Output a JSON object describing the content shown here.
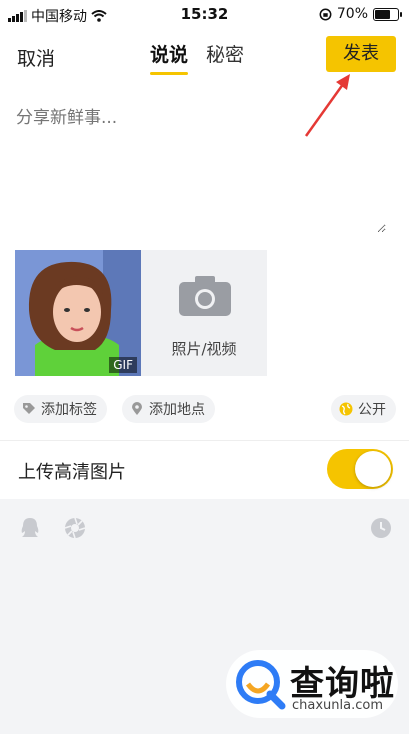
{
  "status_bar": {
    "carrier": "中国移动",
    "time": "15:32",
    "battery_percent": "70%",
    "battery_level": 0.7
  },
  "nav": {
    "cancel_label": "取消",
    "tabs": [
      {
        "label": "说说",
        "active": true
      },
      {
        "label": "秘密",
        "active": false
      }
    ],
    "publish_label": "发表"
  },
  "compose": {
    "placeholder": "分享新鲜事..."
  },
  "media": {
    "thumbnail_badge": "GIF",
    "add_label": "照片/视频"
  },
  "chips": {
    "tag_label": "添加标签",
    "location_label": "添加地点",
    "visibility_label": "公开"
  },
  "upload_hd": {
    "label": "上传高清图片",
    "enabled": true
  },
  "bottom_icons": [
    "qq-icon",
    "aperture-icon",
    "clock-icon"
  ],
  "watermark": {
    "title": "查询啦",
    "subtitle": "chaxunla.com"
  },
  "colors": {
    "accent": "#f5c400",
    "arrow": "#e53935",
    "panel": "#f3f4f6"
  }
}
